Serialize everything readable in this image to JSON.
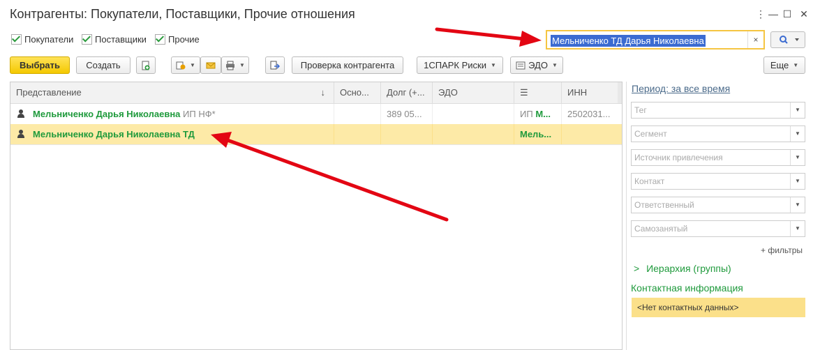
{
  "window": {
    "title": "Контрагенты: Покупатели, Поставщики, Прочие отношения",
    "menu_icon": "⋮",
    "minimize_icon": "—",
    "maximize_icon": "☐",
    "close_icon": "✕"
  },
  "checkboxes": [
    {
      "label": "Покупатели",
      "checked": true
    },
    {
      "label": "Поставщики",
      "checked": true
    },
    {
      "label": "Прочие",
      "checked": true
    }
  ],
  "search": {
    "value": "Мельниченко ТД Дарья Николаевна",
    "clear_icon": "×"
  },
  "toolbar": {
    "select_label": "Выбрать",
    "create_label": "Создать",
    "check_label": "Проверка контрагента",
    "spark_label": "1СПАРК Риски",
    "edo_label": "ЭДО",
    "more_label": "Еще"
  },
  "table": {
    "columns": [
      "Представление",
      "Осно...",
      "Долг (+...",
      "ЭДО",
      "",
      "ИНН"
    ],
    "sort_icon": "↓",
    "list_icon": "☰",
    "rows": [
      {
        "name": "Мельниченко Дарья Николаевна",
        "extra": "ИП НФ*",
        "osn": "",
        "debt": "389 05...",
        "edo": "",
        "type": "ИП",
        "type_strong": "М...",
        "inn": "2502031..."
      },
      {
        "name": "Мельниченко Дарья Николаевна ТД",
        "extra": "",
        "osn": "",
        "debt": "",
        "edo": "",
        "type": "",
        "type_strong": "Мель...",
        "inn": ""
      }
    ]
  },
  "panel": {
    "period_link": "Период: за все время",
    "filters": [
      "Тег",
      "Сегмент",
      "Источник привлечения",
      "Контакт",
      "Ответственный",
      "Самозанятый"
    ],
    "add_filters": "+ фильтры",
    "hierarchy_arrow": ">",
    "hierarchy": "Иерархия (группы)",
    "contact_title": "Контактная информация",
    "contact_empty": "<Нет контактных данных>"
  },
  "colors": {
    "accent_green": "#1f9a3c",
    "selection": "#fdeaa7",
    "arrow": "#e30613",
    "primary_button": "#f4c800"
  }
}
